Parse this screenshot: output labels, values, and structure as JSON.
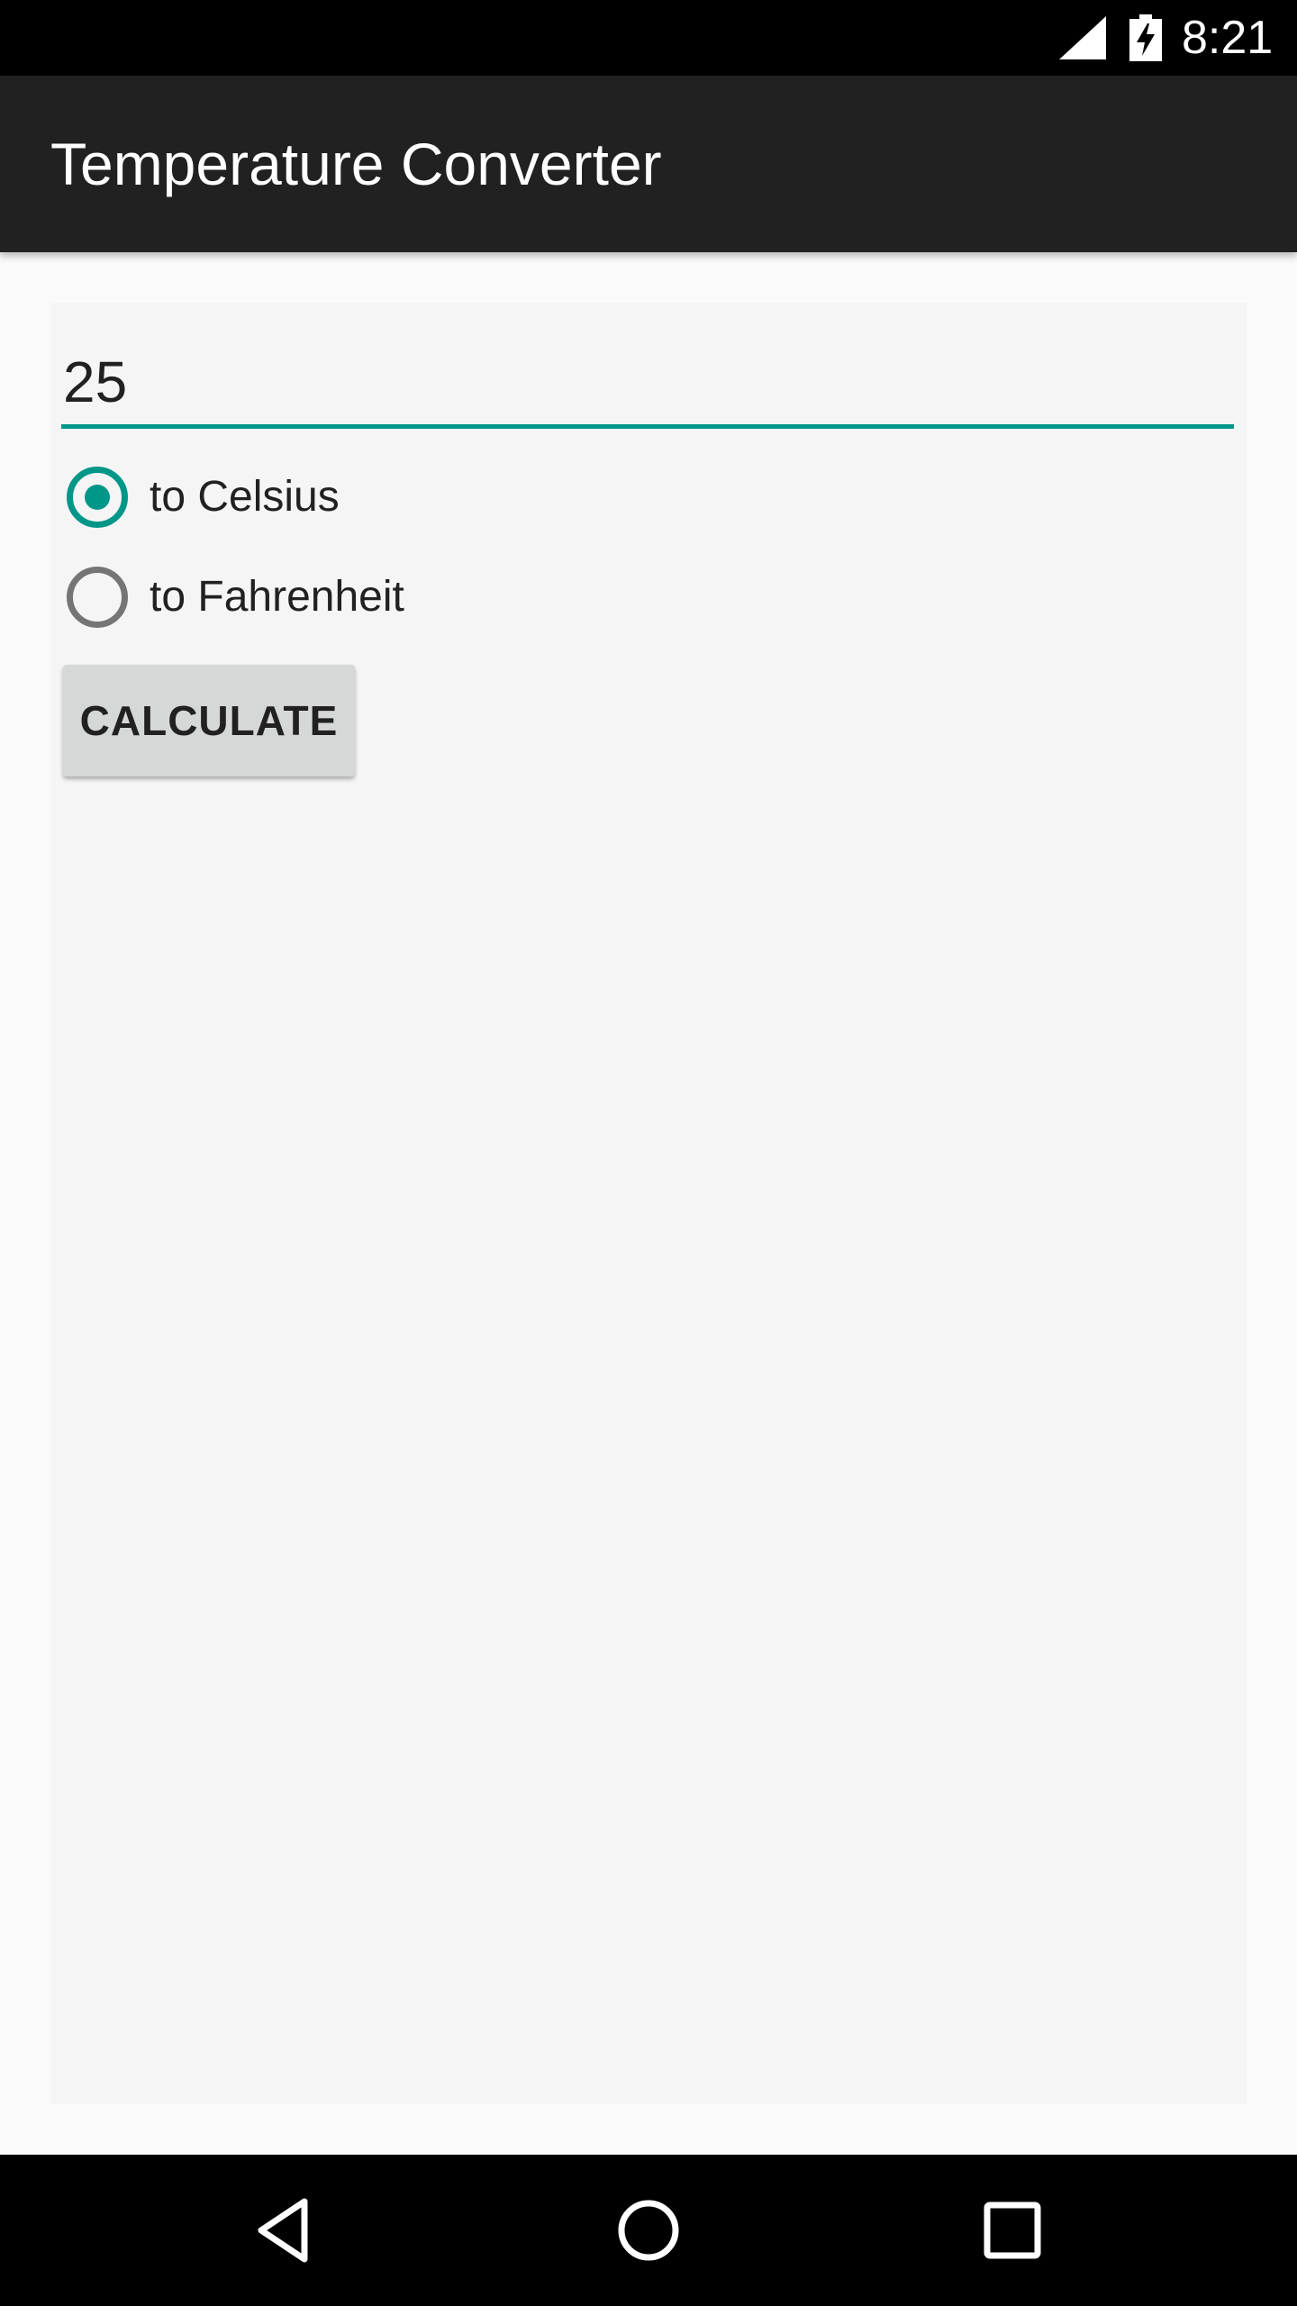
{
  "status_bar": {
    "time": "8:21",
    "icons": [
      "signal-icon",
      "battery-charging-icon"
    ]
  },
  "app_bar": {
    "title": "Temperature Converter",
    "color": "#212121"
  },
  "form": {
    "input_value": "25",
    "accent_color": "#009688",
    "options": [
      {
        "label": "to Celsius",
        "checked": true
      },
      {
        "label": "to Fahrenheit",
        "checked": false
      }
    ],
    "button_label": "CALCULATE"
  },
  "nav_bar": {
    "icons": [
      "back-icon",
      "home-icon",
      "recents-icon"
    ]
  }
}
